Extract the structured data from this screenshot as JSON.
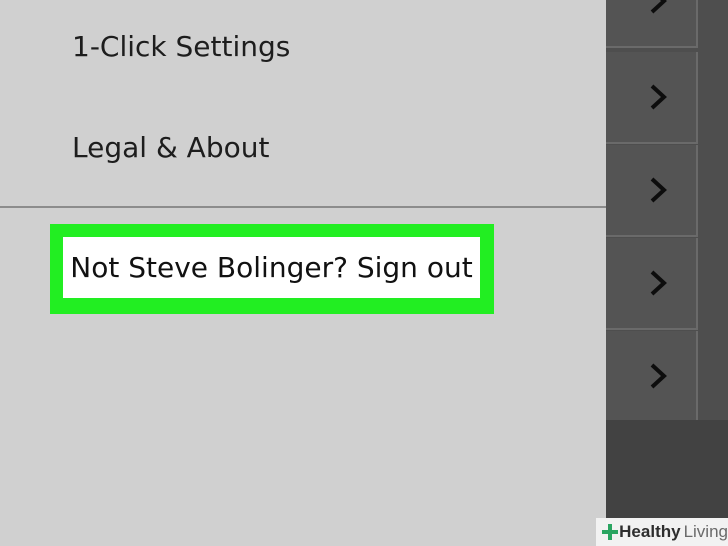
{
  "menu": {
    "items": [
      {
        "label": "1-Click Settings"
      },
      {
        "label": "Legal & About"
      }
    ],
    "signout_label": "Not Steve Bolinger? Sign out"
  },
  "background_overlay": {
    "row_icon": "chevron-right-icon",
    "row_count": 5
  },
  "watermark": {
    "text_bold": "Healthy",
    "text_light": "Living",
    "icon": "plus-logo-icon"
  },
  "colors": {
    "drawer_bg": "#d0d0d0",
    "highlight": "#22ee22",
    "overlay_bg": "#4e4e4e"
  }
}
